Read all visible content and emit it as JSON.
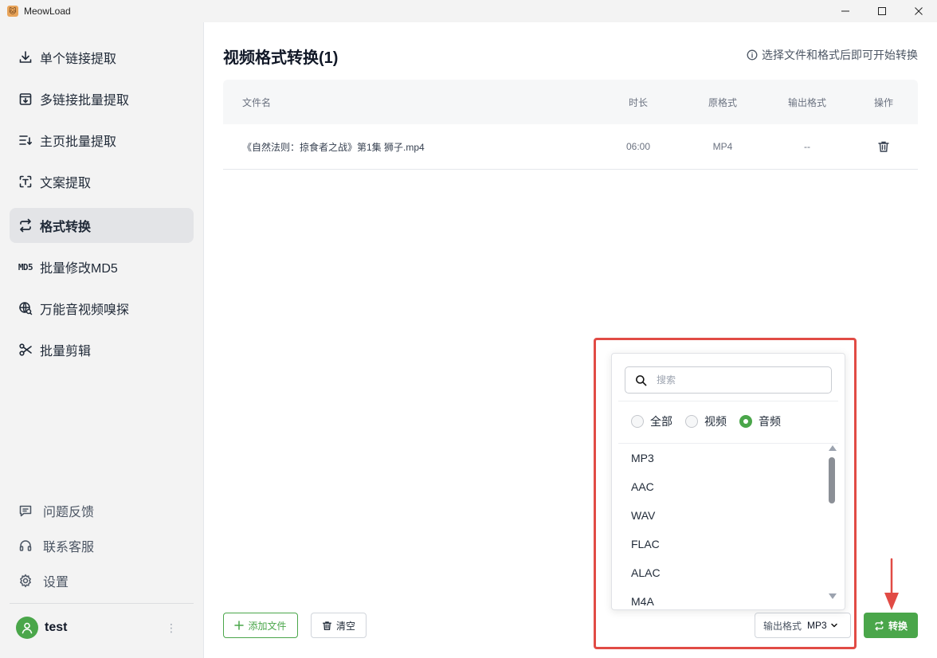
{
  "window": {
    "title": "MeowLoad",
    "minimize_icon": "minimize-icon",
    "maximize_icon": "maximize-icon",
    "close_icon": "close-icon"
  },
  "sidebar": {
    "items": [
      {
        "label": "单个链接提取",
        "icon": "download-icon"
      },
      {
        "label": "多链接批量提取",
        "icon": "batch-download-icon"
      },
      {
        "label": "主页批量提取",
        "icon": "list-download-icon"
      },
      {
        "label": "文案提取",
        "icon": "text-scan-icon"
      },
      {
        "label": "格式转换",
        "icon": "convert-icon",
        "active": true
      },
      {
        "label": "批量修改MD5",
        "icon": "md5-icon",
        "icon_text": "MD5"
      },
      {
        "label": "万能音视频嗅探",
        "icon": "globe-search-icon"
      },
      {
        "label": "批量剪辑",
        "icon": "scissors-icon"
      }
    ],
    "bottom": [
      {
        "label": "问题反馈",
        "icon": "feedback-icon"
      },
      {
        "label": "联系客服",
        "icon": "headset-icon"
      },
      {
        "label": "设置",
        "icon": "gear-icon"
      }
    ],
    "user": {
      "name": "test",
      "more": "⋮"
    }
  },
  "main": {
    "title": "视频格式转换(1)",
    "hint": "选择文件和格式后即可开始转换",
    "table": {
      "headers": [
        "文件名",
        "时长",
        "原格式",
        "输出格式",
        "操作"
      ],
      "rows": [
        {
          "name": "《自然法则：掠食者之战》第1集 狮子.mp4",
          "duration": "06:00",
          "format": "MP4",
          "output": "--"
        }
      ]
    },
    "toolbar": {
      "add_label": "添加文件",
      "clear_label": "清空",
      "output_label": "输出格式",
      "output_value": "MP3",
      "convert_label": "转换"
    }
  },
  "dropdown": {
    "search_placeholder": "搜索",
    "filters": [
      {
        "label": "全部",
        "checked": false
      },
      {
        "label": "视频",
        "checked": false
      },
      {
        "label": "音频",
        "checked": true
      }
    ],
    "options": [
      "MP3",
      "AAC",
      "WAV",
      "FLAC",
      "ALAC",
      "M4A"
    ]
  },
  "colors": {
    "accent": "#4aa64a",
    "annotation": "#e14b45",
    "sidebar_bg": "#f3f3f3"
  }
}
